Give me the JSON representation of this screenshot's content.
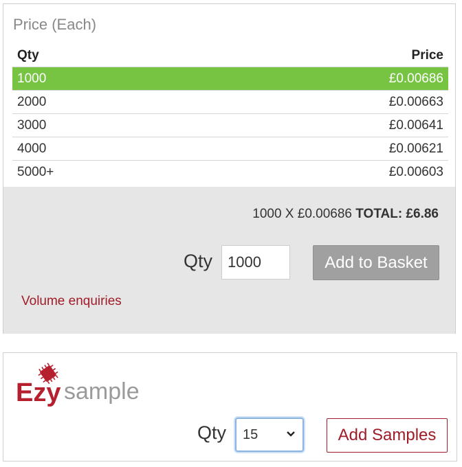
{
  "pricing": {
    "title": "Price (Each)",
    "columns": [
      "Qty",
      "Price"
    ],
    "rows": [
      {
        "qty": "1000",
        "price": "£0.00686"
      },
      {
        "qty": "2000",
        "price": "£0.00663"
      },
      {
        "qty": "3000",
        "price": "£0.00641"
      },
      {
        "qty": "4000",
        "price": "£0.00621"
      },
      {
        "qty": "5000+",
        "price": "£0.00603"
      }
    ],
    "highlight_color": "#76c442"
  },
  "basket": {
    "calculation": "1000 X £0.00686",
    "total_label": "TOTAL: £6.86",
    "qty_label": "Qty",
    "qty_value": "1000",
    "add_button_label": "Add to Basket",
    "volume_enquiries_label": "Volume enquiries",
    "link_color": "#a01c28"
  },
  "samples": {
    "logo_text_ezy": "Ezy",
    "logo_text_sample": "sample",
    "qty_label": "Qty",
    "qty_selected": "15",
    "add_button_label": "Add Samples"
  }
}
